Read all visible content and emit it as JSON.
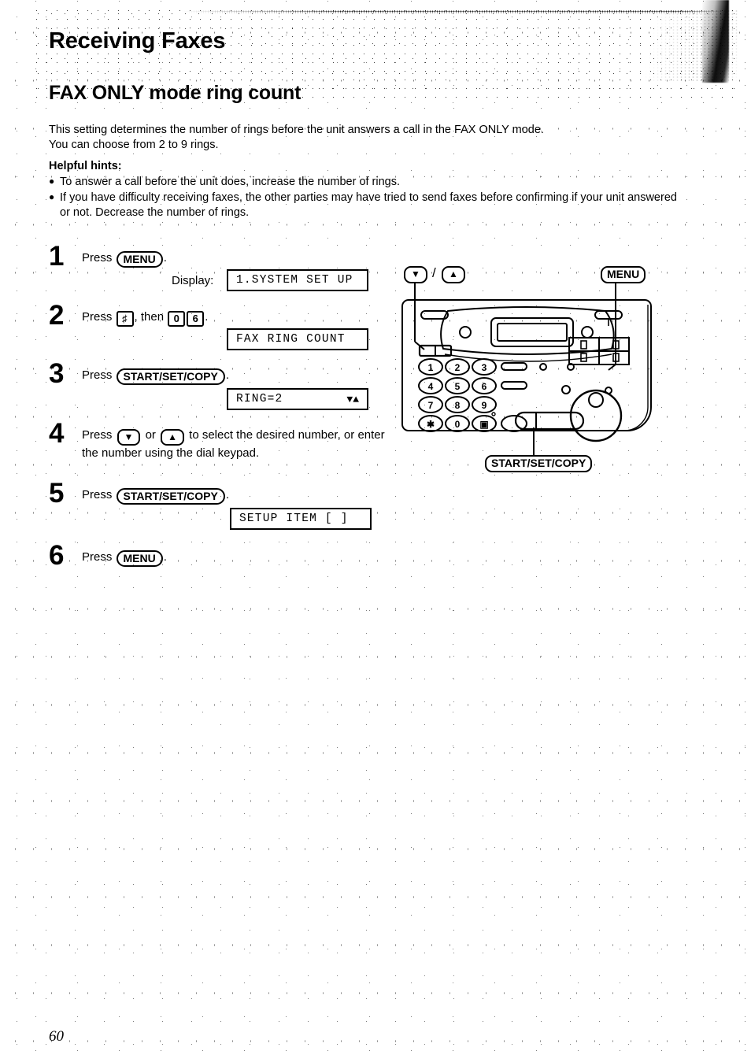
{
  "document": {
    "chapter_title": "Receiving Faxes",
    "section_title": "FAX ONLY mode ring count",
    "page_number": "60"
  },
  "intro": {
    "line1": "This setting determines the number of rings before the unit answers a call in the FAX ONLY mode.",
    "line2": "You can choose from 2 to 9 rings."
  },
  "hints": {
    "label": "Helpful hints:",
    "bullet": "●",
    "items": [
      "To answer a call before the unit does, increase the number of rings.",
      "If you have difficulty receiving faxes, the other parties may have tried to send faxes before confirming if your unit answered or not. Decrease the number of rings."
    ]
  },
  "steps": {
    "s1": {
      "number": "1",
      "press_label": "Press",
      "key": "MENU",
      "period": ".",
      "display_label": "Display:",
      "lcd": "1.SYSTEM SET UP"
    },
    "s2": {
      "number": "2",
      "press_label": "Press",
      "key_hash": "♯",
      "then_label": ", then",
      "key_0": "0",
      "key_6": "6",
      "period": ".",
      "lcd": "FAX RING COUNT"
    },
    "s3": {
      "number": "3",
      "press_label": "Press",
      "key": "START/SET/COPY",
      "period": ".",
      "lcd": "RING=2",
      "lcd_arrows": "▼▲"
    },
    "s4": {
      "number": "4",
      "press_label": "Press",
      "key_down": "▼",
      "or_label": "or",
      "key_up": "▲",
      "text": "to select the desired number, or enter the number using the dial keypad."
    },
    "s5": {
      "number": "5",
      "press_label": "Press",
      "key": "START/SET/COPY",
      "period": ".",
      "lcd": "SETUP ITEM [  ]"
    },
    "s6": {
      "number": "6",
      "press_label": "Press",
      "key": "MENU",
      "period": "."
    }
  },
  "diagram": {
    "callout_arrows": "▼",
    "callout_arrows_up": "▲",
    "callout_slash": "/",
    "callout_menu": "MENU",
    "callout_start": "START/SET/COPY",
    "keypad": [
      "1",
      "2",
      "3",
      "4",
      "5",
      "6",
      "7",
      "8",
      "9",
      "✱",
      "0",
      "▣"
    ]
  }
}
